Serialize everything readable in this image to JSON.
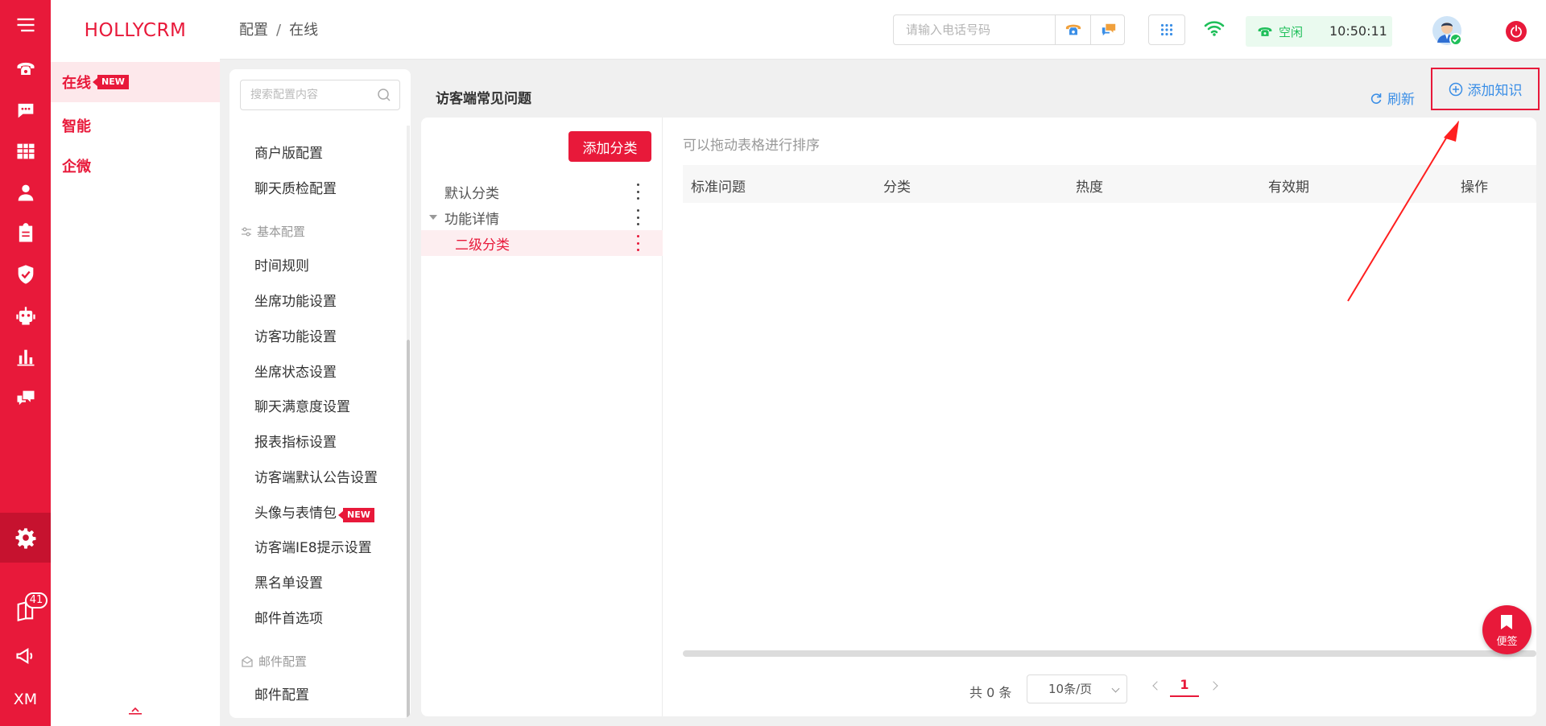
{
  "app": {
    "brand": "HOLLYCRM"
  },
  "rail": {
    "badge_count": "41",
    "footer_text": "XM"
  },
  "nav2": {
    "items": [
      {
        "label": "在线",
        "tag": "NEW"
      },
      {
        "label": "智能"
      },
      {
        "label": "企微"
      }
    ]
  },
  "header": {
    "breadcrumb": {
      "parent": "配置",
      "separator": "/",
      "current": "在线"
    },
    "phone_placeholder": "请输入电话号码",
    "agent_status": "空闲",
    "clock": "10:50:11"
  },
  "config_menu": {
    "search_placeholder": "搜索配置内容",
    "top_items": [
      "商户版配置",
      "聊天质检配置"
    ],
    "groups": [
      {
        "title": "基本配置",
        "items": [
          "时间规则",
          "坐席功能设置",
          "访客功能设置",
          "坐席状态设置",
          "聊天满意度设置",
          "报表指标设置",
          "访客端默认公告设置",
          "头像与表情包",
          "访客端IE8提示设置",
          "黑名单设置",
          "邮件首选项"
        ],
        "item_tag": {
          "index": 7,
          "tag": "NEW"
        }
      },
      {
        "title": "邮件配置",
        "items": [
          "邮件配置"
        ]
      }
    ]
  },
  "main": {
    "title": "访客端常见问题",
    "refresh_label": "刷新",
    "add_knowledge_label": "添加知识",
    "add_category_label": "添加分类",
    "tree": [
      {
        "label": "默认分类"
      },
      {
        "label": "功能详情",
        "expanded": true
      },
      {
        "label": "二级分类",
        "selected": true
      }
    ],
    "drag_hint": "可以拖动表格进行排序",
    "table_columns": [
      "标准问题",
      "分类",
      "热度",
      "有效期",
      "操作"
    ],
    "table_rows": [],
    "pagination": {
      "total_text": "共 0 条",
      "page_size": "10条/页",
      "current_page": "1"
    },
    "note_button_label": "便签"
  },
  "colors": {
    "accent": "#e8193a",
    "link": "#3a8ee6",
    "status_green": "#1fbf5a"
  }
}
